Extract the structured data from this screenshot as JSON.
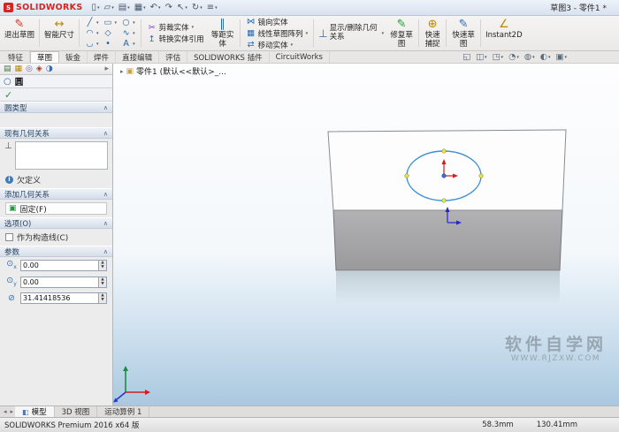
{
  "titlebar": {
    "logo_text": "SOLIDWORKS",
    "title": "草图3 - 零件1 *"
  },
  "ribbon": {
    "exit_sketch": "退出草图",
    "smart_dimension": "智能尺寸",
    "trim_entities": "剪裁实体",
    "convert_entities": "转换实体引用",
    "offset_entities": "等距实体",
    "mirror_entities": "镜向实体",
    "linear_sketch_pattern": "线性草图阵列",
    "move_entities": "移动实体",
    "display_delete_relations": "显示/删除几何关系",
    "repair_sketch": "修复草图",
    "quick_snaps": "快速捕捉",
    "rapid_sketch": "快速草图",
    "instant2d": "Instant2D"
  },
  "tabs": {
    "items": [
      "特征",
      "草图",
      "钣金",
      "焊件",
      "直接编辑",
      "评估",
      "SOLIDWORKS 插件",
      "CircuitWorks"
    ]
  },
  "viewport": {
    "breadcrumb": "零件1 (默认<<默认>_...",
    "watermark_line1": "软件自学网",
    "watermark_line2": "WWW.RJZXW.COM"
  },
  "panel": {
    "title": "圆",
    "circle_type_header": "圆类型",
    "existing_relations_header": "现有几何关系",
    "underdefined": "欠定义",
    "add_relations_header": "添加几何关系",
    "fix_label": "固定(F)",
    "options_header": "选项(O)",
    "construction_label": "作为构造线(C)",
    "parameters_header": "参数",
    "param_x": "0.00",
    "param_y": "0.00",
    "param_radius": "31.41418536"
  },
  "bottom_tabs": {
    "model": "模型",
    "views_3d": "3D 视图",
    "motion_study": "运动算例 1"
  },
  "statusbar": {
    "app": "SOLIDWORKS Premium 2016 x64 版",
    "dim1": "58.3mm",
    "dim2": "130.41mm"
  },
  "colors": {
    "sketch_blue": "#3d8fd6",
    "viewport_bottom": "#a9c8df",
    "brand_red": "#d02724"
  }
}
